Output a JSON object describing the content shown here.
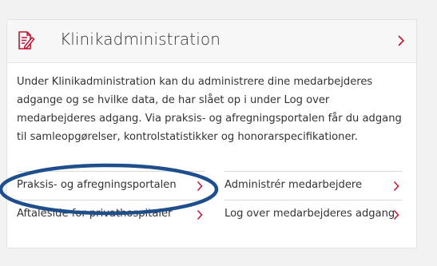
{
  "card": {
    "title": "Klinikadministration",
    "header_icon": "document-edit-icon",
    "header_chevron_icon": "chevron-right-icon",
    "description": "Under Klinikadministration kan du administrere dine medarbejderes adgange og se hvilke data, de har slået op i under Log over medarbejderes adgang. Via praksis- og afregningsportalen får du adgang til samleopgørelser, kontrolstatistikker og honorarspecifikationer.",
    "links": [
      {
        "label": "Praksis- og afregningsportalen"
      },
      {
        "label": "Administrér medarbejdere"
      },
      {
        "label": "Aftaleside for privathospitaler"
      },
      {
        "label": "Log over medarbejderes adgang"
      }
    ]
  },
  "colors": {
    "accent": "#c8102e",
    "annotation": "#1f4e8c",
    "text": "#333333"
  }
}
